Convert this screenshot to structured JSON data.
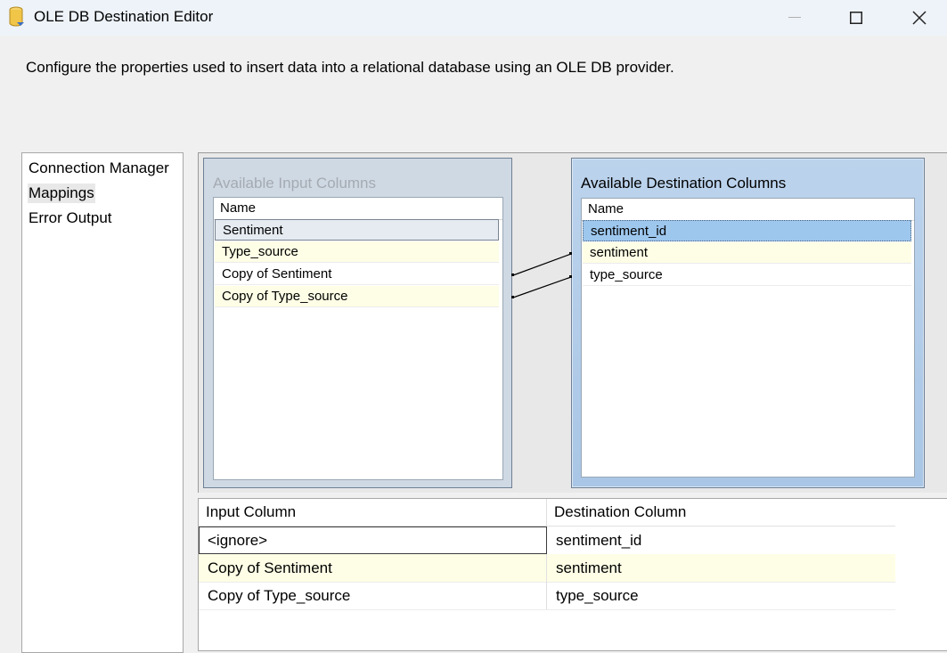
{
  "window": {
    "title": "OLE DB Destination Editor",
    "icon": "database-cylinder-icon"
  },
  "description": "Configure the properties used to insert data into a relational database using an OLE DB provider.",
  "nav": {
    "items": [
      {
        "label": "Connection Manager",
        "selected": false
      },
      {
        "label": "Mappings",
        "selected": true
      },
      {
        "label": "Error Output",
        "selected": false
      }
    ]
  },
  "input_columns": {
    "title": "Available Input Columns",
    "header": "Name",
    "rows": [
      "Sentiment",
      "Type_source",
      "Copy of Sentiment",
      "Copy of Type_source"
    ]
  },
  "dest_columns": {
    "title": "Available Destination Columns",
    "header": "Name",
    "rows": [
      "sentiment_id",
      "sentiment",
      "type_source"
    ]
  },
  "mappings_grid": {
    "headers": [
      "Input Column",
      "Destination Column"
    ],
    "rows": [
      {
        "input": "<ignore>",
        "destination": "sentiment_id"
      },
      {
        "input": "Copy of Sentiment",
        "destination": "sentiment"
      },
      {
        "input": "Copy of Type_source",
        "destination": "type_source"
      }
    ]
  },
  "colors": {
    "titlebar": "#eef3f9",
    "highlight_row": "#fefee6",
    "selected_dest": "#9ec7ee"
  }
}
